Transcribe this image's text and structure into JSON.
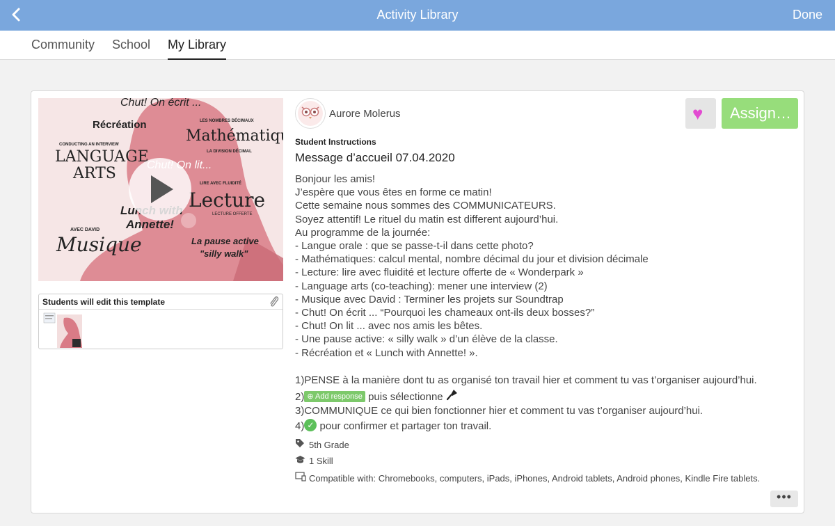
{
  "header": {
    "title": "Activity Library",
    "done_label": "Done",
    "back_icon": "chevron-left-icon"
  },
  "tabs": [
    {
      "label": "Community",
      "active": false
    },
    {
      "label": "School",
      "active": false
    },
    {
      "label": "My Library",
      "active": true
    }
  ],
  "activity": {
    "thumbnail_text": {
      "t1": "Chut! On écrit ...",
      "t2": "Récréation",
      "t3": "LES NOMBRES DÉCIMAUX",
      "t4": "Mathématiques",
      "t5": "CONDUCTING AN INTERVIEW",
      "t6": "LANGUAGE",
      "t7": "ARTS",
      "t8": "LA DIVISION DÉCIMAL",
      "t9": "Chut! On lit...",
      "t10": "LIRE AVEC FLUIDITÉ",
      "t11": "Lecture",
      "t12": "LECTURE OFFERTE",
      "t13": "Lunch with",
      "t14": "Annette!",
      "t15": "AVEC DAVID",
      "t16": "Musique",
      "t17": "La pause active",
      "t18": "\"silly walk\""
    },
    "template_label": "Students will edit this template",
    "author": "Aurore Molerus",
    "assign_label": "Assign…",
    "instructions_label": "Student Instructions",
    "title": "Message d’accueil 07.04.2020",
    "body_lines": [
      "Bonjour les amis!",
      "J’espère que vous êtes en forme ce matin!",
      "Cette semaine nous sommes des COMMUNICATEURS.",
      "Soyez attentif! Le rituel du matin est different aujourd’hui.",
      "Au programme de la journée:",
      "- Langue orale : que se passe-t-il dans cette photo?",
      "- Mathématiques: calcul mental, nombre décimal du jour et division décimale",
      "- Lecture: lire avec fluidité et lecture offerte de « Wonderpark »",
      "- Language arts (co-teaching): mener une interview (2)",
      "- Musique avec David : Terminer les projets sur Soundtrap",
      "- Chut! On écrit ... “Pourquoi les chameaux ont-ils deux bosses?”",
      "- Chut! On lit ...  avec nos amis les bêtes.",
      "- Une pause active: « silly walk » d’un élève de la classe.",
      "- Récréation et « Lunch with Annette! »."
    ],
    "steps": {
      "s1": "1)PENSE à la manière dont tu as organisé ton travail hier et comment tu vas t’organiser aujourd’hui.",
      "s2_prefix": "2)",
      "s2_button": "Add response",
      "s2_suffix": " puis sélectionne",
      "s3": "3)COMMUNIQUE ce qui bien fonctionner hier et comment tu vas t’organiser aujourd’hui.",
      "s4_prefix": "4)",
      "s4_suffix": " pour confirmer et partager ton travail."
    },
    "grade": "5th Grade",
    "skills": "1 Skill",
    "compatible": "Compatible with: Chromebooks, computers, iPads, iPhones, Android tablets, Android phones, Kindle Fire tablets."
  },
  "colors": {
    "topbar": "#7aa7dd",
    "assign": "#97dd7b",
    "heart": "#e24bd1",
    "add_response": "#7dc96b"
  }
}
